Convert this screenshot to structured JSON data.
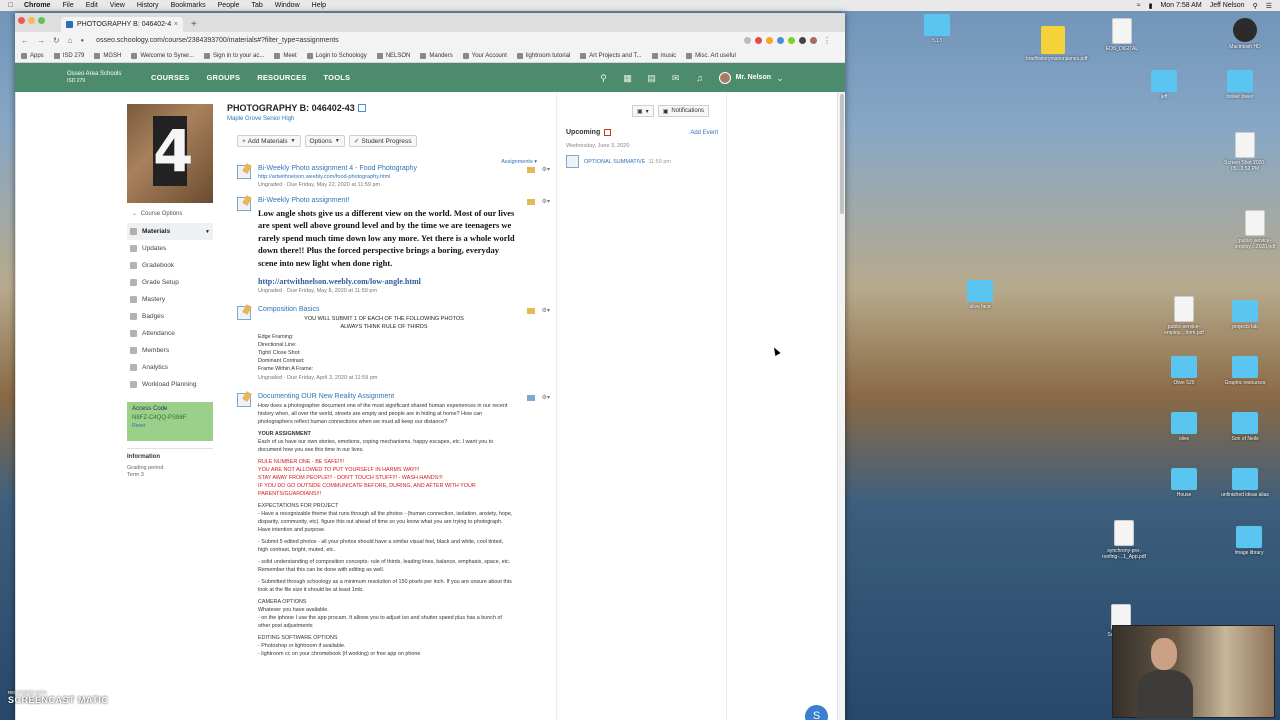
{
  "menubar": {
    "app": "Chrome",
    "items": [
      "File",
      "Edit",
      "View",
      "History",
      "Bookmarks",
      "People",
      "Tab",
      "Window",
      "Help"
    ],
    "clock": "Mon 7:58 AM",
    "user": "Jeff Nelson"
  },
  "browser": {
    "tab_title": "PHOTOGRAPHY B: 046402-4",
    "url": "osseo.schoology.com/course/2384393700/materials#?filter_type=assignments",
    "bookmarks": [
      "Apps",
      "ISD 279",
      "MGSH",
      "Welcome to Syner...",
      "Sign in to your ac...",
      "Meet",
      "Login to Schoology",
      "NELSON",
      "Manders",
      "Your Account",
      "lightroom tutorial",
      "Art Projects and T...",
      "music",
      "Misc. Art useful"
    ]
  },
  "header": {
    "logo_line1": "Osseo Area Schools",
    "logo_line2": "ISD 279",
    "nav": [
      "COURSES",
      "GROUPS",
      "RESOURCES",
      "TOOLS"
    ],
    "user": "Mr. Nelson",
    "badge1": "2",
    "badge2": "1"
  },
  "sidebar": {
    "course_number": "4",
    "course_options": "Course Options",
    "links": [
      "Materials",
      "Updates",
      "Gradebook",
      "Grade Setup",
      "Mastery",
      "Badges",
      "Attendance",
      "Members",
      "Analytics",
      "Workload Planning"
    ],
    "access_title": "Access Code",
    "access_code": "N8FZ-C4QQ-PS86F",
    "access_reset": "Reset",
    "info_title": "Information",
    "grading_label": "Grading period",
    "grading_value": "Term 3"
  },
  "main": {
    "course_title": "PHOTOGRAPHY B: 046402-43",
    "school": "Maple Grove Senior High",
    "add_materials": "Add Materials",
    "options": "Options",
    "student_progress": "Student Progress",
    "filter": "Assignments",
    "notifications": "Notifications",
    "materials": [
      {
        "title": "Bi-Weekly Photo assignment 4 - Food Photography",
        "link": "http://artwithnelson.weebly.com/food-photography.html",
        "due": "Ungraded · Due Friday, May 22, 2020 at 11:59 pm"
      },
      {
        "title": "Bi-Weekly Photo assignment!",
        "body": "Low angle shots give us a different view on the world. Most of our lives are spent well above ground level and by the time we are teenagers we rarely spend much time down low any more. Yet there is a whole world down there!! Plus the forced perspective brings a boring, everyday scene into new light when done right.",
        "link": "http://artwithnelson.weebly.com/low-angle.html",
        "due": "Ungraded · Due Friday, May 8, 2020 at 11:59 pm"
      },
      {
        "title": "Composition Basics",
        "line1": "YOU WILL SUBMIT 1 OF EACH OF THE FOLLOWING PHOTOS",
        "line2": "ALWAYS THINK RULE OF THIRDS",
        "items": [
          "Edge Framing:",
          "Directional Line:",
          "Tight/ Close Shot:",
          "Dominant Contrast:",
          "Frame Within A Frame:"
        ],
        "due": "Ungraded · Due Friday, April 3, 2020 at 11:59 pm"
      },
      {
        "title": "Documenting OUR New Reality Assignment",
        "intro": "How does a photographer document one of the most significant shared human experiences in our recent history when, all over the world, streets are empty and people are in hiding at home? How can photographers reflect human connections when we must all keep our distance?",
        "your_assignment": "YOUR ASSIGNMENT",
        "assignment_text": "Each of us have our own stories, emotions, coping mechanisms, happy escapes, etc. I want you to document how you see this time in our lives.",
        "rules": [
          "RULE NUMBER ONE - BE SAFE!!!!",
          "YOU ARE NOT ALLOWED TO PUT YOURSELF IN HARMS WAY!!!",
          "STAY AWAY FROM PEOPLE!!! - DON'T TOUCH STUFF!!! - WASH HANDS!!!",
          "IF YOU DO GO OUTSIDE COMMUNICATE BEFORE, DURING, AND AFTER WITH YOUR PARENTS/GUARDIANS!!!"
        ],
        "expectations_title": "EXPECTATIONS FOR PROJECT",
        "expectations": [
          "- Have a recognizable theme that runs through all the photos - (human connection, isolation, anxiety, hope, disparity, community, etc). figure this out ahead of time so you know what you are trying to photograph. Have intention and purpose.",
          "- Submit 5 edited photos - all your photos should have a similar visual feel, black and white, cool tinted, high contrast, bright, muted, etc.",
          "- solid understanding of composition concepts- rule of thirds, leading lines, balance, emphasis, space, etc. Remember that this can be done with editing as well.",
          "- Submitted through schoology as a minimum resolution of 150 pixels per inch. If you are unsure about this look at the file size it should be at least 1mb."
        ],
        "camera_title": "CAMERA OPTIONS",
        "camera": [
          "Whatever you have available.",
          "- on the iphone I use the app procam. It allows you to adjust iso and shutter speed plus has a bunch of other post adjustments"
        ],
        "editing_title": "EDITING SOFTWARE OPTIONS",
        "editing": [
          "- Photoshop or lightroom if available.",
          "- lightroom cc on your chromebook (if working) or free app on phone"
        ]
      }
    ]
  },
  "upcoming": {
    "title": "Upcoming",
    "add_event": "Add Event",
    "date": "Wednesday, June 3, 2020",
    "event_name": "OPTIONAL SUMMATIVE",
    "event_time": "11:59 pm"
  },
  "chat_letter": "S",
  "desktop": [
    {
      "label": "5.13",
      "kind": "folder"
    },
    {
      "label": "Macintosh HD",
      "kind": "dark"
    },
    {
      "label": "EOS_DIGITAL",
      "kind": "doc"
    },
    {
      "label": "briefhistorymarionjames.pdf",
      "kind": "yellow"
    },
    {
      "label": "jeff",
      "kind": "folder"
    },
    {
      "label": "toolier tower",
      "kind": "folder"
    },
    {
      "label": "Screen Shot 2020-05...3.52 PM",
      "kind": "doc"
    },
    {
      "label": "public-service-employ....2020.pdf",
      "kind": "doc"
    },
    {
      "label": "olive face",
      "kind": "folder"
    },
    {
      "label": "public-service-employ....form.pdf",
      "kind": "doc"
    },
    {
      "label": "projects lab",
      "kind": "folder"
    },
    {
      "label": "Olive 529",
      "kind": "folder"
    },
    {
      "label": "Graphic resources",
      "kind": "folder"
    },
    {
      "label": "olive",
      "kind": "folder"
    },
    {
      "label": "Son of Neils",
      "kind": "folder"
    },
    {
      "label": "House",
      "kind": "folder"
    },
    {
      "label": "unfinished ideas alias",
      "kind": "folder"
    },
    {
      "label": "synchrony-pro-roofing-...1_App.pdf",
      "kind": "doc"
    },
    {
      "label": "Image library",
      "kind": "folder"
    },
    {
      "label": "Scre 2020-0",
      "kind": "doc"
    }
  ],
  "screencast": {
    "line1": "RECORDED WITH",
    "line2": "SCREENCAST MATIC"
  }
}
